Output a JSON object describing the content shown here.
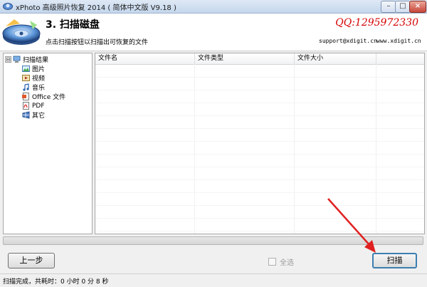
{
  "window": {
    "title": "xPhoto 高级照片恢复 2014 ( 简体中文版 V9.18 )",
    "min_icon": "minimize-icon",
    "max_icon": "maximize-icon",
    "close_icon": "close-icon",
    "min_glyph": "–",
    "max_glyph": "□",
    "close_glyph": "×"
  },
  "header": {
    "step_title": "3. 扫描磁盘",
    "description": "点击扫描按钮以扫描出可恢复的文件",
    "qq": "QQ:1295972330",
    "email": "support@xdigit.cn",
    "website": "www.xdigit.cn",
    "qq_color": "#d40000"
  },
  "tree": {
    "root": {
      "label": "扫描结果",
      "icon": "computer-icon",
      "expander": "⊟"
    },
    "items": [
      {
        "label": "图片",
        "icon": "image-icon"
      },
      {
        "label": "视频",
        "icon": "video-icon"
      },
      {
        "label": "音乐",
        "icon": "music-note-icon"
      },
      {
        "label": "Office 文件",
        "icon": "office-document-icon"
      },
      {
        "label": "PDF",
        "icon": "pdf-icon"
      },
      {
        "label": "其它",
        "icon": "other-files-icon"
      }
    ]
  },
  "file_list": {
    "columns": [
      "文件名",
      "文件类型",
      "文件大小"
    ],
    "rows": []
  },
  "progress": {
    "value": 0
  },
  "buttons": {
    "prev": "上一步",
    "scan": "扫描",
    "select_all": "全选",
    "select_all_checked": false,
    "select_all_enabled": false
  },
  "status": {
    "text": "扫描完成，共耗时：0 小时 0 分 8 秒"
  },
  "colors": {
    "accent_arrow": "#e02020",
    "scan_button_border": "#3c7fb1"
  }
}
